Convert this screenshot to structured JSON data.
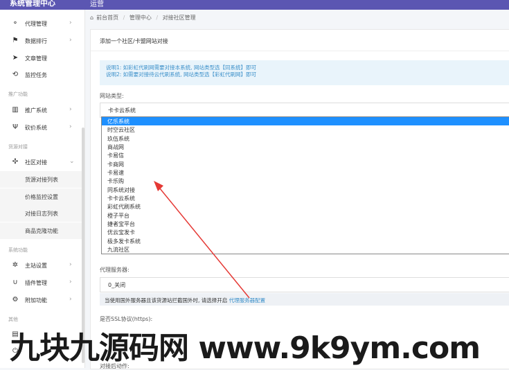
{
  "topbar": {
    "brand": "系统管理中心",
    "title": "运营"
  },
  "sidebar": {
    "items": [
      {
        "icon": "org-icon",
        "glyph": "⚬",
        "label": "代理管理"
      },
      {
        "icon": "flag-icon",
        "glyph": "⚑",
        "label": "数据排行"
      },
      {
        "icon": "send-icon",
        "glyph": "➤",
        "label": "文章管理"
      },
      {
        "icon": "repeat-icon",
        "glyph": "⟲",
        "label": "监控任务"
      }
    ],
    "section_promo": "推广功能",
    "promo_items": [
      {
        "icon": "bar-chart-icon",
        "glyph": "▥",
        "label": "推广系统"
      },
      {
        "icon": "fork-icon",
        "glyph": "Ψ",
        "label": "砍价系统"
      }
    ],
    "section_source": "货源对接",
    "source_item": {
      "icon": "users-icon",
      "glyph": "✣",
      "label": "社区对接"
    },
    "source_subs": [
      "货源对接列表",
      "价格监控设置",
      "对接日志列表",
      "商品克隆功能"
    ],
    "section_system": "系统功能",
    "system_items": [
      {
        "icon": "gear-icon",
        "glyph": "✲",
        "label": "主站设置"
      },
      {
        "icon": "magnet-icon",
        "glyph": "∪",
        "label": "插件管理"
      },
      {
        "icon": "cogs-icon",
        "glyph": "⚙",
        "label": "附加功能"
      }
    ],
    "section_other": "其他",
    "other_items": [
      {
        "icon": "file-icon",
        "glyph": "▤",
        "label": ""
      },
      {
        "icon": "power-icon",
        "glyph": "⏻",
        "label": ""
      }
    ]
  },
  "breadcrumb": [
    "前台首页",
    "管理中心",
    "对接社区管理"
  ],
  "card": {
    "title": "添加一个社区/卡盟网站对接",
    "info_line1": "说明1: 如彩虹代刷网需要对接本系统, 网站类型选【同系统】即可",
    "info_line2": "说明2: 如需要对接待云代刷系统, 网站类型选【彩虹代刷网】即可",
    "site_type_label": "网站类型:",
    "site_type_value": "卡卡云系统",
    "options": [
      "亿乐系统",
      "时空云社区",
      "玖伍系统",
      "商战网",
      "卡易信",
      "卡商网",
      "卡易速",
      "卡乐购",
      "同系统对接",
      "卡卡云系统",
      "彩虹代刷系统",
      "橙子平台",
      "捷者宝平台",
      "优云宝发卡",
      "极多发卡系统",
      "九流社区"
    ],
    "selected_option": "亿乐系统",
    "proxy_label": "代理服务器:",
    "proxy_value": "0_关闭",
    "proxy_help": "当使用国外服务器且该货源站拦截国外时, 请选择开启",
    "proxy_help_link": "代理服务器配置",
    "ssl_label": "是否SSL协议(https):",
    "auto_label": "对接后动作:"
  },
  "watermark": "九块九源码网 www.9k9ym.com",
  "colors": {
    "accent": "#5b56b2",
    "selected": "#1e90ff",
    "link": "#3a8fc9",
    "arrow": "#e53935"
  }
}
